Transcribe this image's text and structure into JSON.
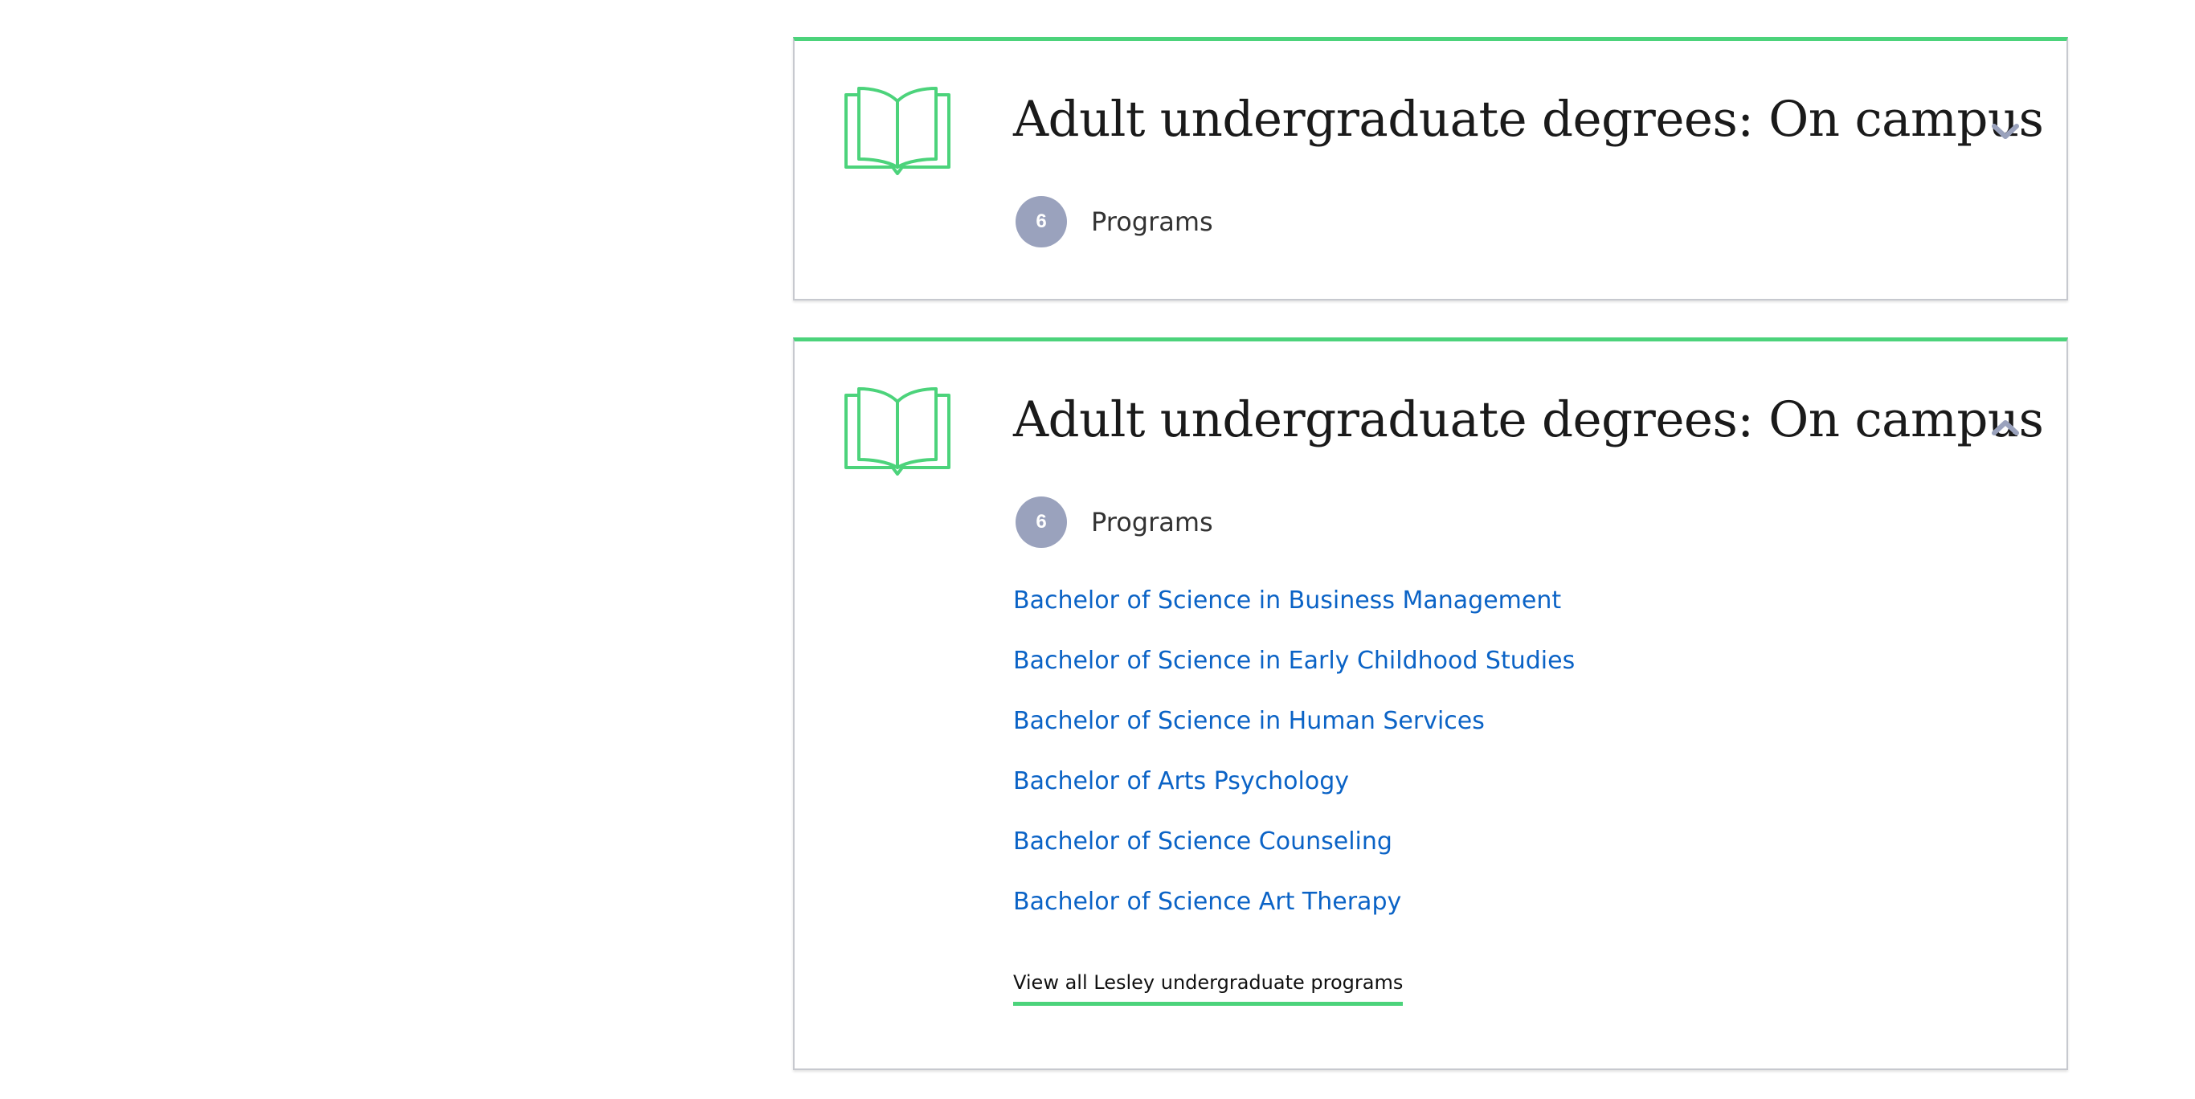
{
  "colors": {
    "accent": "#4cd37b",
    "link": "#0b63c6",
    "badge": "#9aa2bd",
    "chevron": "#9aa2bd",
    "border": "#c7c9cf"
  },
  "cards": [
    {
      "state": "collapsed",
      "icon": "open-book-icon",
      "toggle_icon": "chevron-down-icon",
      "title": "Adult undergraduate degrees: On campus",
      "count": "6",
      "count_label": "Programs"
    },
    {
      "state": "expanded",
      "icon": "open-book-icon",
      "toggle_icon": "chevron-up-icon",
      "title": "Adult undergraduate degrees: On campus",
      "count": "6",
      "count_label": "Programs",
      "programs": [
        "Bachelor of Science in Business Management",
        "Bachelor of Science in Early Childhood Studies",
        "Bachelor of Science in Human Services",
        "Bachelor of Arts Psychology",
        "Bachelor of Science Counseling",
        "Bachelor of Science Art Therapy"
      ],
      "view_all": "View all Lesley undergraduate programs"
    }
  ]
}
